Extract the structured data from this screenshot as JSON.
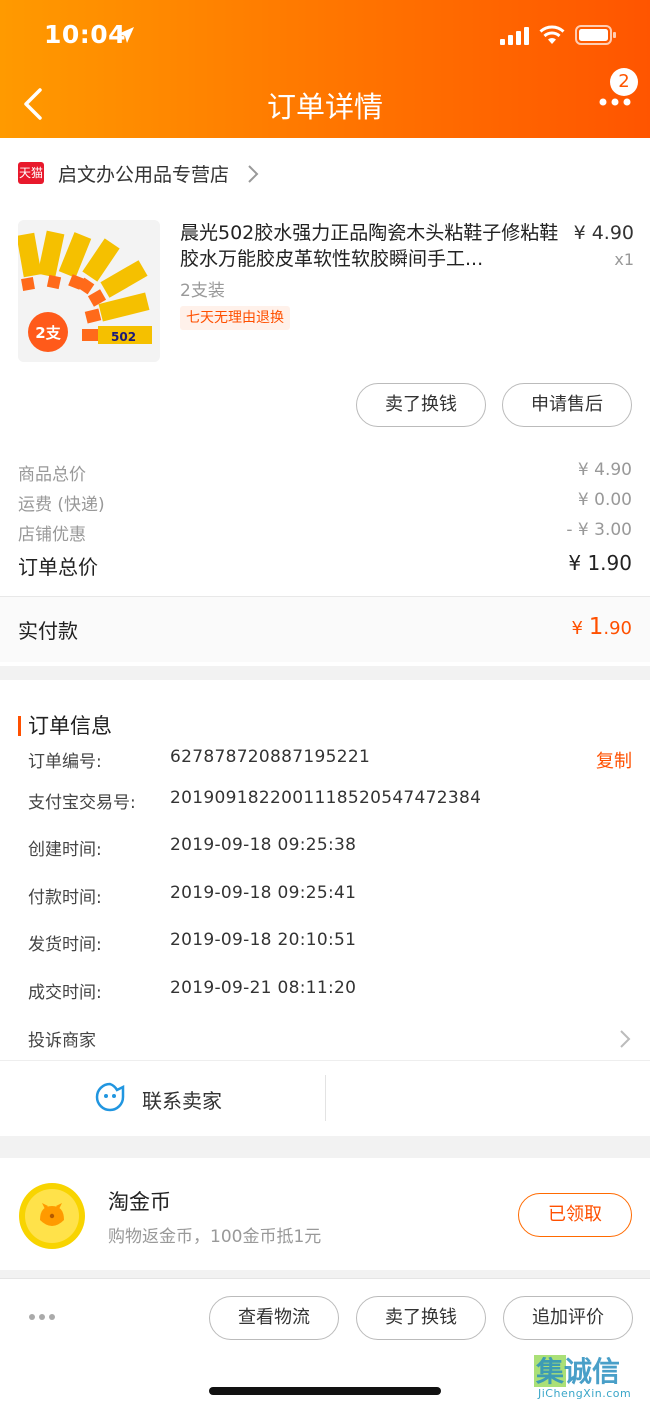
{
  "status_bar": {
    "time": "10:04"
  },
  "nav": {
    "title": "订单详情",
    "badge_count": "2"
  },
  "store": {
    "badge": "天猫",
    "name": "启文办公用品专营店"
  },
  "product": {
    "title": "晨光502胶水强力正品陶瓷木头粘鞋子修粘鞋胶水万能胶皮革软性软胶瞬间手工...",
    "price": "¥ 4.90",
    "quantity": "x1",
    "spec": "2支装",
    "return_tag": "七天无理由退换",
    "image_badge": "2支",
    "tube_label": "502"
  },
  "item_actions": {
    "sell": "卖了换钱",
    "after_sale": "申请售后"
  },
  "summary": {
    "goods_total_label": "商品总价",
    "goods_total": "¥ 4.90",
    "shipping_label": "运费 (快递)",
    "shipping": "¥ 0.00",
    "discount_label": "店铺优惠",
    "discount": "- ¥ 3.00",
    "order_total_label": "订单总价",
    "order_total": "¥ 1.90",
    "paid_label": "实付款",
    "paid_currency": "¥ ",
    "paid_int": "1",
    "paid_dec": ".90"
  },
  "order_info": {
    "title": "订单信息",
    "copy": "复制",
    "rows": [
      {
        "key": "订单编号:",
        "value": "627878720887195221"
      },
      {
        "key": "支付宝交易号:",
        "value": "2019091822001118520547472384"
      },
      {
        "key": "创建时间:",
        "value": "2019-09-18 09:25:38"
      },
      {
        "key": "付款时间:",
        "value": "2019-09-18 09:25:41"
      },
      {
        "key": "发货时间:",
        "value": "2019-09-18 20:10:51"
      },
      {
        "key": "成交时间:",
        "value": "2019-09-21 08:11:20"
      }
    ],
    "complain": "投诉商家",
    "contact": "联系卖家"
  },
  "coins": {
    "title": "淘金币",
    "desc": "购物返金币，100金币抵1元",
    "button": "已领取"
  },
  "bottom_actions": {
    "logistics": "查看物流",
    "sell": "卖了换钱",
    "review": "追加评价"
  },
  "watermark": {
    "chars": "集诚信",
    "domain": "JiChengXin.com"
  },
  "colors": {
    "accent": "#ff5000",
    "header_start": "#ff9a00",
    "header_end": "#ff5500"
  }
}
